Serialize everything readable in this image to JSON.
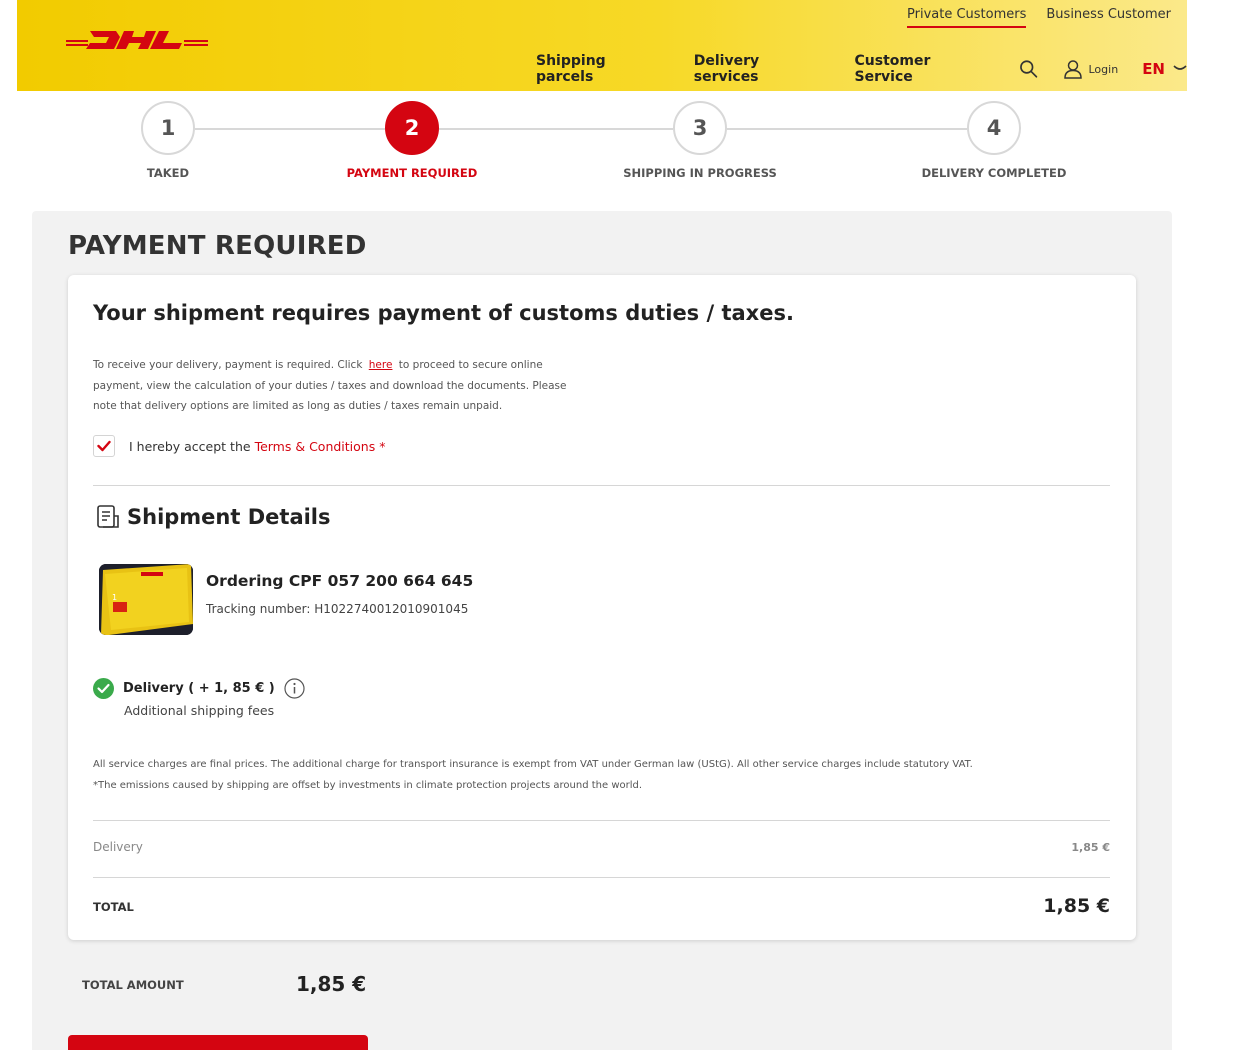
{
  "header": {
    "logo_text": "DHL",
    "top_links": [
      "Private Customers",
      "Business Customer"
    ],
    "nav": [
      "Shipping parcels",
      "Delivery services",
      "Customer Service"
    ],
    "login": "Login",
    "language": "EN"
  },
  "stepper": {
    "steps": [
      {
        "number": "1",
        "label": "TAKED"
      },
      {
        "number": "2",
        "label": "PAYMENT REQUIRED"
      },
      {
        "number": "3",
        "label": "SHIPPING IN PROGRESS"
      },
      {
        "number": "4",
        "label": "DELIVERY COMPLETED"
      }
    ],
    "active_step": 2
  },
  "page": {
    "title": "PAYMENT REQUIRED",
    "heading": "Your shipment requires payment of customs duties / taxes.",
    "intro_before": "To receive your delivery, payment is required. Click",
    "intro_link": "here",
    "intro_after": "to proceed to secure online payment, view the calculation of your duties / taxes and download the documents. Please note that delivery options are limited as long as duties / taxes remain unpaid.",
    "accept_text": "I hereby accept the",
    "terms_link": "Terms & Conditions *",
    "accept_checked": true
  },
  "shipment": {
    "section_title": "Shipment Details",
    "order_title": "Ordering CPF 057 200 664 645",
    "tracking": "Tracking number: H1022740012010901045",
    "delivery_option": "Delivery ( + 1, 85 € )",
    "delivery_sub": "Additional shipping fees",
    "fineprint_1": "All service charges are final prices. The additional charge for transport insurance is exempt from VAT under German law (UStG). All other service charges include statutory VAT.",
    "fineprint_2": "*The emissions caused by shipping are offset by investments in climate protection projects around the world."
  },
  "summary": {
    "delivery_label": "Delivery",
    "delivery_value": "1,85 €",
    "total_label": "TOTAL",
    "total_value": "1,85 €",
    "total_amount_label": "TOTAL AMOUNT",
    "total_amount_value": "1,85 €"
  },
  "colors": {
    "dhl_yellow": "#f2cb00",
    "dhl_red": "#d40511",
    "panel_bg": "#f2f2f2",
    "success_green": "#3aaa4b"
  }
}
